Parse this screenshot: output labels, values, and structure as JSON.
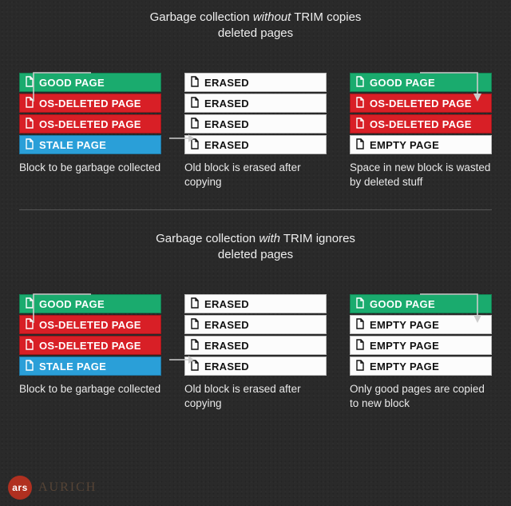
{
  "sections": [
    {
      "title_pre": "Garbage collection ",
      "title_em": "without",
      "title_post": " TRIM copies",
      "title_line2": "deleted pages",
      "columns": [
        {
          "caption": "Block to be garbage collected",
          "pages": [
            {
              "label": "GOOD PAGE",
              "cls": "green",
              "icon": "light"
            },
            {
              "label": "OS-DELETED PAGE",
              "cls": "red",
              "icon": "light"
            },
            {
              "label": "OS-DELETED PAGE",
              "cls": "red",
              "icon": "light"
            },
            {
              "label": "STALE PAGE",
              "cls": "blue",
              "icon": "light"
            }
          ]
        },
        {
          "caption": "Old block is erased after copying",
          "pages": [
            {
              "label": "ERASED",
              "cls": "white",
              "icon": "dark"
            },
            {
              "label": "ERASED",
              "cls": "white",
              "icon": "dark"
            },
            {
              "label": "ERASED",
              "cls": "white",
              "icon": "dark"
            },
            {
              "label": "ERASED",
              "cls": "white",
              "icon": "dark"
            }
          ]
        },
        {
          "caption": "Space in new block is wasted by deleted stuff",
          "pages": [
            {
              "label": "GOOD PAGE",
              "cls": "green",
              "icon": "light"
            },
            {
              "label": "OS-DELETED PAGE",
              "cls": "red",
              "icon": "light"
            },
            {
              "label": "OS-DELETED PAGE",
              "cls": "red",
              "icon": "light"
            },
            {
              "label": "EMPTY PAGE",
              "cls": "white",
              "icon": "dark"
            }
          ]
        }
      ]
    },
    {
      "title_pre": "Garbage collection ",
      "title_em": "with",
      "title_post": " TRIM ignores",
      "title_line2": "deleted pages",
      "columns": [
        {
          "caption": "Block to be garbage collected",
          "pages": [
            {
              "label": "GOOD PAGE",
              "cls": "green",
              "icon": "light"
            },
            {
              "label": "OS-DELETED PAGE",
              "cls": "red",
              "icon": "light"
            },
            {
              "label": "OS-DELETED PAGE",
              "cls": "red",
              "icon": "light"
            },
            {
              "label": "STALE PAGE",
              "cls": "blue",
              "icon": "light"
            }
          ]
        },
        {
          "caption": "Old block is erased after copying",
          "pages": [
            {
              "label": "ERASED",
              "cls": "white",
              "icon": "dark"
            },
            {
              "label": "ERASED",
              "cls": "white",
              "icon": "dark"
            },
            {
              "label": "ERASED",
              "cls": "white",
              "icon": "dark"
            },
            {
              "label": "ERASED",
              "cls": "white",
              "icon": "dark"
            }
          ]
        },
        {
          "caption": "Only good pages are copied to new block",
          "pages": [
            {
              "label": "GOOD PAGE",
              "cls": "green",
              "icon": "light"
            },
            {
              "label": "EMPTY PAGE",
              "cls": "white",
              "icon": "dark"
            },
            {
              "label": "EMPTY PAGE",
              "cls": "white",
              "icon": "dark"
            },
            {
              "label": "EMPTY PAGE",
              "cls": "white",
              "icon": "dark"
            }
          ]
        }
      ]
    }
  ],
  "footer": {
    "badge": "ars",
    "signature": "AURICH"
  }
}
